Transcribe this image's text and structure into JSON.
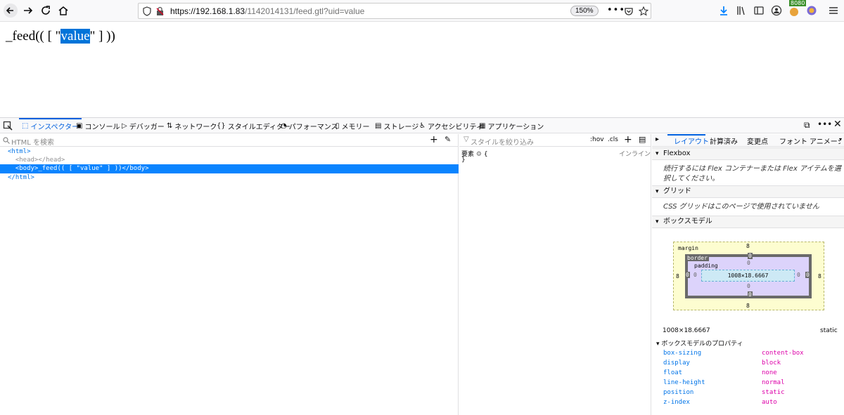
{
  "browser": {
    "url_host": "https://192.168.1.83",
    "url_path": "/1142014131/feed.gtl?uid=value",
    "zoom": "150%",
    "badge": "8080"
  },
  "page": {
    "text_before": "_feed(( [ \"",
    "text_highlight": "value",
    "text_after": "\" ] ))"
  },
  "devtools": {
    "tabs": [
      "インスペクター",
      "コンソール",
      "デバッガー",
      "ネットワーク",
      "スタイルエディター",
      "パフォーマンス",
      "メモリー",
      "ストレージ",
      "アクセシビリティ",
      "アプリケーション"
    ],
    "html_search_placeholder": "HTML を検索",
    "tree": [
      "<html>",
      "  <head></head>",
      "  <body>_feed(( [ \"value\" ] ))</body>",
      "</html>"
    ],
    "styles_filter_placeholder": "スタイルを絞り込み",
    "hov": ":hov",
    "cls": ".cls",
    "rule_label": "要素",
    "rule_open": "{",
    "rule_close": "}",
    "inline_label": "インライン",
    "right_tabs": [
      "レイアウト",
      "計算済み",
      "変更点",
      "フォント",
      "アニメーション"
    ],
    "flexbox_title": "Flexbox",
    "flexbox_note": "続行するには Flex コンテナーまたは Flex アイテムを選択してください。",
    "grid_title": "グリッド",
    "grid_note": "CSS グリッドはこのページで使用されていません",
    "boxmodel_title": "ボックスモデル",
    "boxmodel": {
      "margin_label": "margin",
      "border_label": "border",
      "padding_label": "padding",
      "margin": "8",
      "border": "0",
      "padding": "0",
      "content": "1008×18.6667"
    },
    "size_readout": "1008×18.6667",
    "position_readout": "static",
    "props_title": "ボックスモデルのプロパティ",
    "props": [
      {
        "name": "box-sizing",
        "value": "content-box"
      },
      {
        "name": "display",
        "value": "block"
      },
      {
        "name": "float",
        "value": "none"
      },
      {
        "name": "line-height",
        "value": "normal"
      },
      {
        "name": "position",
        "value": "static"
      },
      {
        "name": "z-index",
        "value": "auto"
      }
    ]
  }
}
